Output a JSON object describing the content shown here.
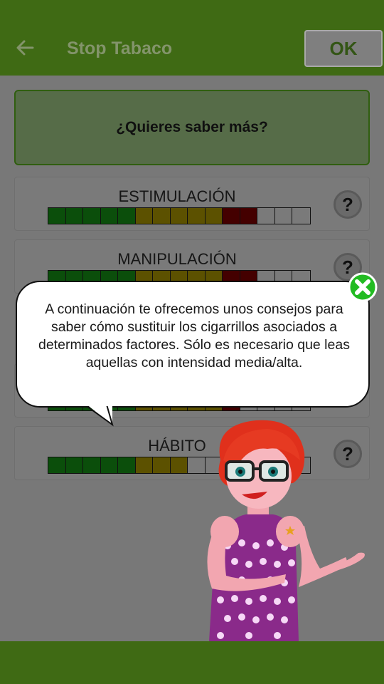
{
  "appbar": {
    "title": "Stop Tabaco",
    "ok_label": "OK"
  },
  "more_button": {
    "label": "¿Quieres saber más?"
  },
  "factors": [
    {
      "label": "ESTIMULACIÓN",
      "levels": [
        "g",
        "g",
        "g",
        "g",
        "g",
        "y",
        "y",
        "y",
        "y",
        "y",
        "r",
        "r",
        "e",
        "e",
        "e"
      ]
    },
    {
      "label": "MANIPULACIÓN",
      "levels": [
        "g",
        "g",
        "g",
        "g",
        "g",
        "y",
        "y",
        "y",
        "y",
        "y",
        "r",
        "r",
        "e",
        "e",
        "e"
      ]
    },
    {
      "label": "",
      "levels": [
        "g",
        "g",
        "g",
        "g",
        "g",
        "y",
        "y",
        "y",
        "y",
        "y",
        "r",
        "e",
        "e",
        "e",
        "e"
      ]
    },
    {
      "label": "HÁBITO",
      "levels": [
        "g",
        "g",
        "g",
        "g",
        "g",
        "y",
        "y",
        "y",
        "e",
        "e",
        "e",
        "e",
        "e",
        "e",
        "e"
      ]
    }
  ],
  "help_symbol": "?",
  "bubble": {
    "text": "A continuación te ofrecemos unos consejos para saber cómo sustituir los cigarrillos asociados a determinados factores. Sólo es necesario que leas aquellas con intensidad media/alta."
  },
  "colors": {
    "appbar": "#3f6a14",
    "scale_green": "#1a9b1a",
    "scale_yellow": "#b8a000",
    "scale_red": "#8b0000",
    "close_green": "#22bb22"
  },
  "icons": [
    "back-arrow-icon",
    "help-icon",
    "close-icon",
    "character-illustration"
  ]
}
